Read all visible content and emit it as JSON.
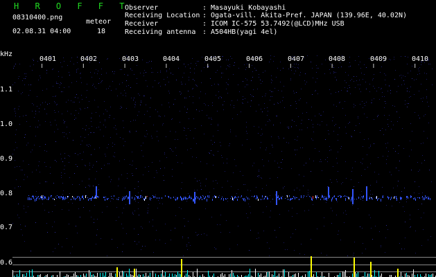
{
  "header": {
    "title": "H R O F F T",
    "filename": "08310400.png",
    "datetime": "02.08.31 04:00",
    "meteor_label": "meteor",
    "meteor_count": "18"
  },
  "info": [
    {
      "key": "Observer",
      "value": ": Masayuki Kobayashi"
    },
    {
      "key": "Receiving Location",
      "value": ": Ogata-vill. Akita-Pref. JAPAN (139.96E, 40.02N)"
    },
    {
      "key": "Receiver",
      "value": ": ICOM IC-575 53.7492(@LCD)MHz USB"
    },
    {
      "key": "Receiving antenna",
      "value": ": A504HB(yagi 4el)"
    }
  ],
  "axis": {
    "unit": "kHz",
    "y_ticks": [
      "1.1",
      "1.0",
      "0.9",
      "0.8",
      "0.7",
      "0.6"
    ],
    "x_ticks": [
      "0401",
      "0402",
      "0403",
      "0404",
      "0405",
      "0406",
      "0407",
      "0408",
      "0409",
      "0410"
    ]
  },
  "colors": {
    "background": "#000000",
    "noise": "#1a1a66",
    "signal_blue": "#3355ff",
    "signal_white": "#ffffff",
    "signal_red": "#ff3333",
    "title_green": "#22dd22",
    "count_yellow": "#ffff00",
    "count_cyan": "#00ffff"
  }
}
